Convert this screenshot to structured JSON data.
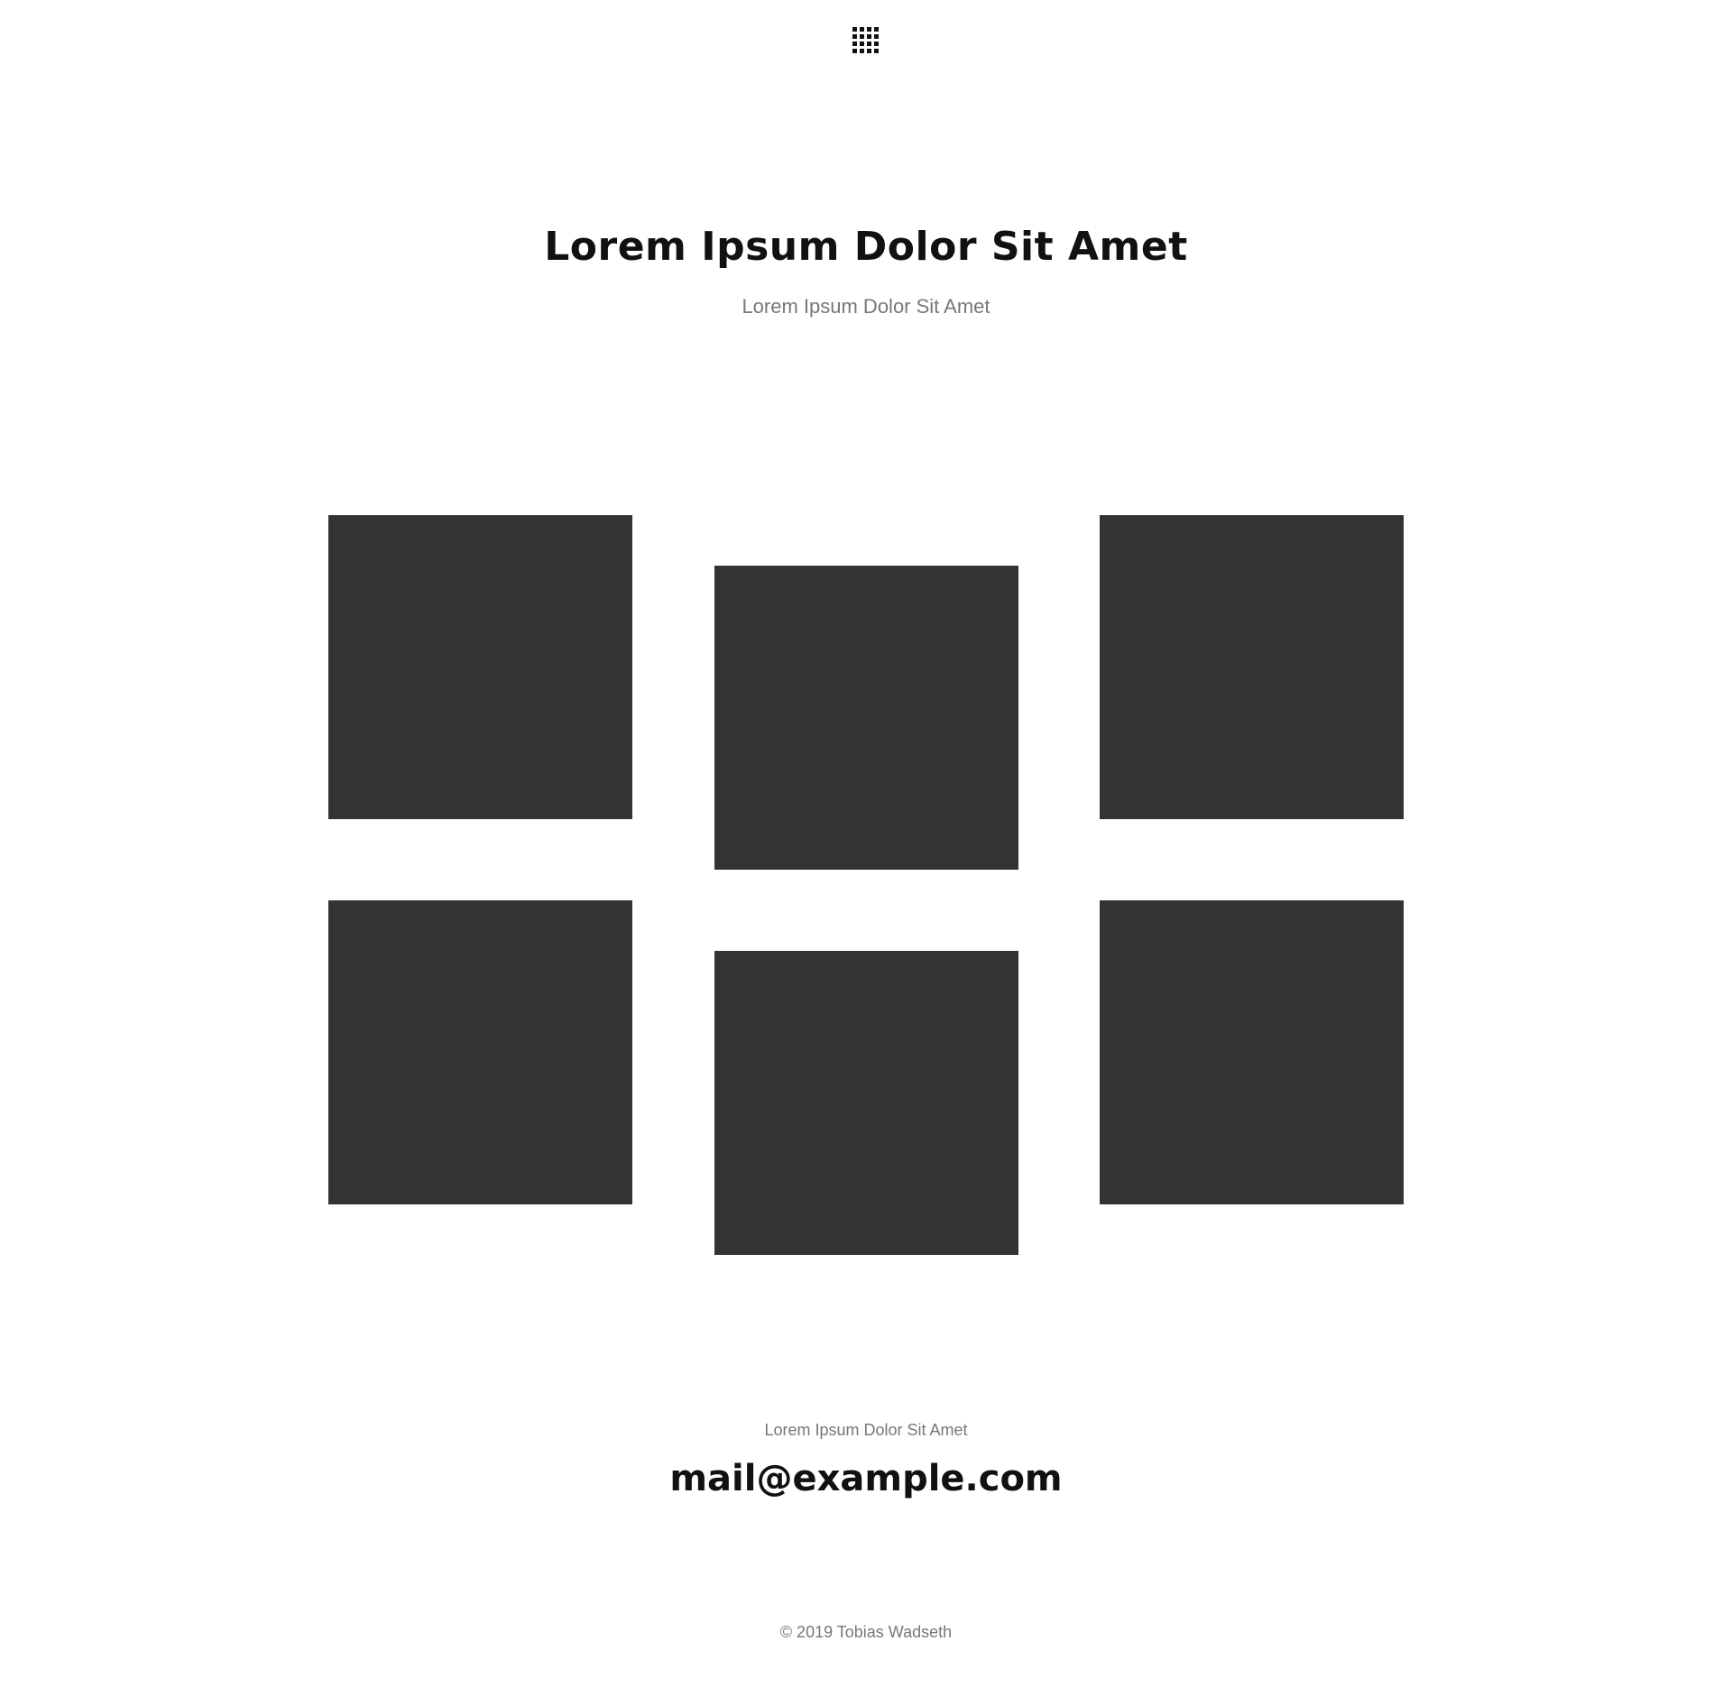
{
  "header": {
    "menu_icon": "grid-menu-icon",
    "title": "Lorem Ipsum Dolor Sit Amet",
    "subtitle": "Lorem Ipsum Dolor Sit Amet"
  },
  "gallery": {
    "tile_color": "#333333",
    "tiles": [
      {
        "id": "tile-1"
      },
      {
        "id": "tile-2"
      },
      {
        "id": "tile-3"
      },
      {
        "id": "tile-4"
      },
      {
        "id": "tile-5"
      },
      {
        "id": "tile-6"
      }
    ]
  },
  "contact": {
    "label": "Lorem Ipsum Dolor Sit Amet",
    "email": "mail@example.com"
  },
  "footer": {
    "copyright": "© 2019 Tobias Wadseth"
  },
  "colors": {
    "text_primary": "#111111",
    "text_secondary": "#777777",
    "background": "#ffffff"
  }
}
